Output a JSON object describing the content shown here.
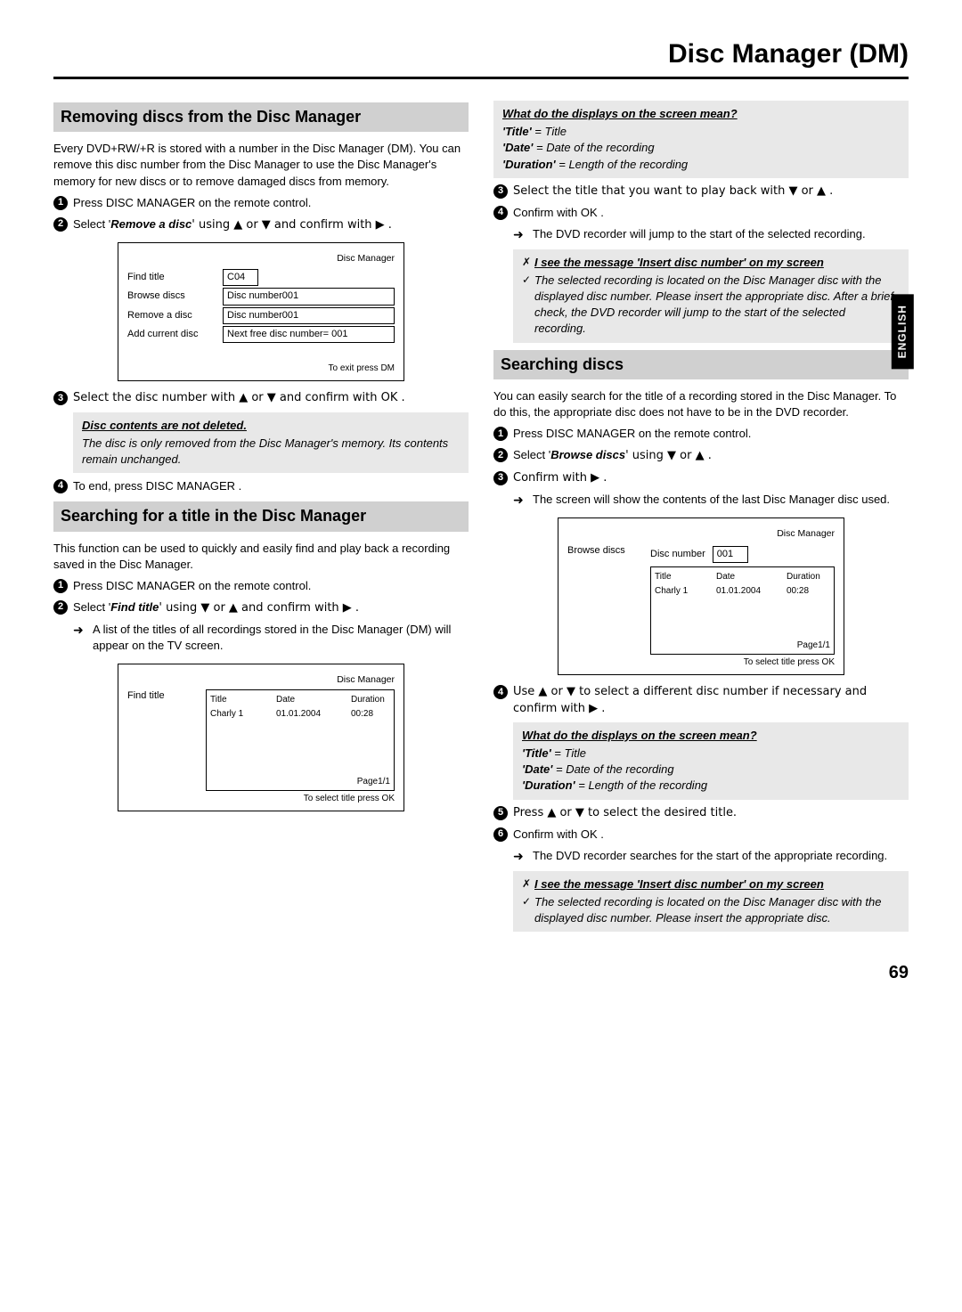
{
  "page_title": "Disc Manager (DM)",
  "side_tab": "ENGLISH",
  "page_number": "69",
  "left": {
    "h1": "Removing discs from the Disc Manager",
    "intro": "Every DVD+RW/+R is stored with a number in the Disc Manager (DM). You can remove this disc number from the Disc Manager to use the Disc Manager's memory for new discs or to remove damaged discs from memory.",
    "s1": "Press  DISC MANAGER on the remote control.",
    "s2a": "Select '",
    "s2b": "Remove a disc",
    "s2c": "' using ▲ or ▼ and confirm with ▶ .",
    "osd1": {
      "header": "Disc Manager",
      "rows": [
        {
          "label": "Find title",
          "field": "C04"
        },
        {
          "label": "Browse discs",
          "field": "Disc number001"
        },
        {
          "label": "Remove a disc",
          "field": "Disc number001"
        },
        {
          "label": "Add current disc",
          "field": "Next free disc number= 001"
        }
      ],
      "footer": "To exit press DM"
    },
    "s3": "Select the disc number with ▲ or ▼ and confirm with  OK .",
    "note1_title": "Disc contents are not deleted.",
    "note1_body": "The disc is only removed from the Disc Manager's memory. Its contents remain unchanged.",
    "s4": "To end, press  DISC MANAGER .",
    "h2": "Searching for a title in the Disc Manager",
    "intro2": "This function can be used to quickly and easily find and play back a recording saved in the Disc Manager.",
    "b1": "Press  DISC MANAGER on the remote control.",
    "b2a": "Select '",
    "b2b": "Find title",
    "b2c": "' using ▼ or ▲ and confirm with ▶ .",
    "b2sub": "A list of the titles of all recordings stored in the Disc Manager (DM) will appear on the TV screen.",
    "osd2": {
      "header": "Disc Manager",
      "left_label": "Find title",
      "cols": [
        "Title",
        "Date",
        "Duration"
      ],
      "row": [
        "Charly 1",
        "01.01.2004",
        "00:28"
      ],
      "page": "Page1/1",
      "footer": "To select title press OK"
    }
  },
  "right": {
    "note_top_title": "What do the displays on the screen mean?",
    "note_top_l1a": "'Title'",
    "note_top_l1b": " = Title",
    "note_top_l2a": "'Date'",
    "note_top_l2b": " = Date of the recording",
    "note_top_l3a": "'Duration'",
    "note_top_l3b": " = Length of the recording",
    "r3": "Select the title that you want to play back with ▼ or ▲ .",
    "r4": "Confirm with  OK .",
    "r4sub": "The DVD recorder will jump to the start of the selected recording.",
    "note2_x": "I see the message 'Insert disc number' on my screen",
    "note2_body": "The selected recording is located on the Disc Manager disc with the displayed disc number. Please insert the appropriate disc. After a brief check, the DVD recorder will jump to the start of the selected recording.",
    "h3": "Searching discs",
    "intro3": "You can easily search for the title of a recording stored in the Disc Manager. To do this, the appropriate disc does not have to be in the DVD recorder.",
    "c1": "Press  DISC MANAGER on the remote control.",
    "c2a": "Select '",
    "c2b": "Browse discs",
    "c2c": "' using ▼ or ▲ .",
    "c3": "Confirm with ▶ .",
    "c3sub": "The screen will show the contents of the last Disc Manager disc used.",
    "osd3": {
      "header": "Disc Manager",
      "left_label": "Browse discs",
      "dn_label": "Disc number",
      "dn_val": "001",
      "cols": [
        "Title",
        "Date",
        "Duration"
      ],
      "row": [
        "Charly 1",
        "01.01.2004",
        "00:28"
      ],
      "page": "Page1/1",
      "footer": "To select title press OK"
    },
    "c4": "Use ▲ or ▼ to select a different disc number if necessary and confirm with ▶ .",
    "note_mid_title": "What do the displays on the screen mean?",
    "note_mid_l1a": "'Title'",
    "note_mid_l1b": " = Title",
    "note_mid_l2a": "'Date'",
    "note_mid_l2b": " = Date of the recording",
    "note_mid_l3a": "'Duration'",
    "note_mid_l3b": " = Length of the recording",
    "c5": "Press ▲ or ▼ to select the desired title.",
    "c6": "Confirm with  OK .",
    "c6sub": "The DVD recorder searches for the start of the appropriate recording.",
    "note3_x": "I see the message 'Insert disc number' on my screen",
    "note3_body": "The selected recording is located on the Disc Manager disc with the displayed disc number. Please insert the appropriate disc."
  }
}
